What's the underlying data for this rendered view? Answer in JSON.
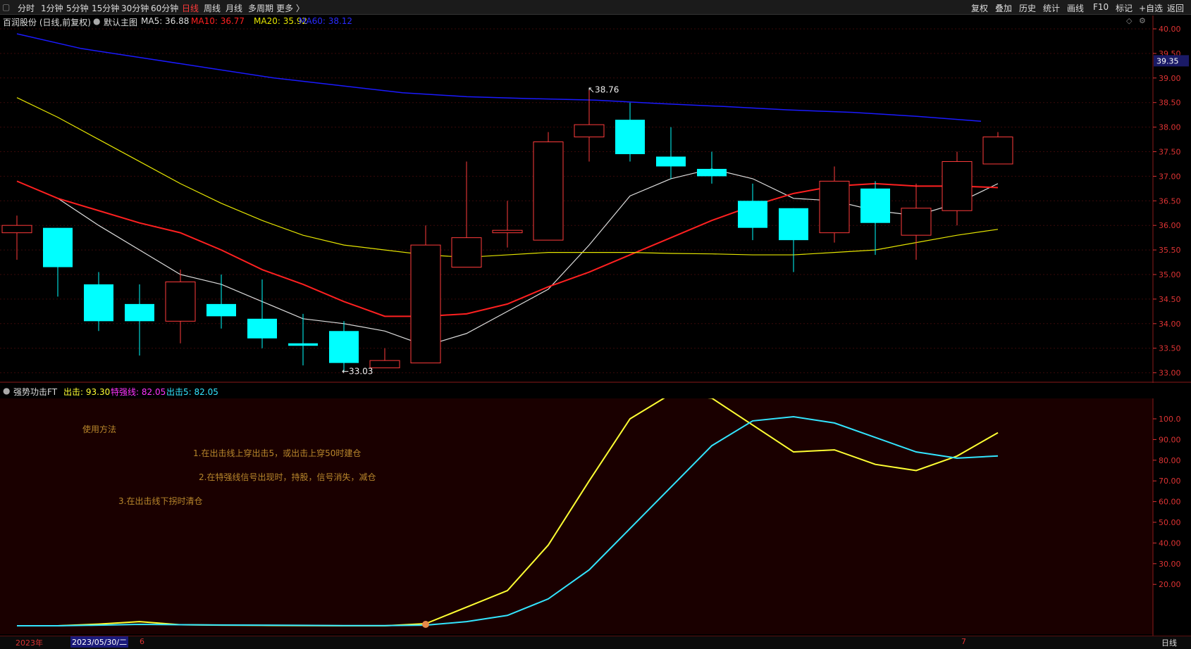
{
  "toolbar": {
    "left_items": [
      "分时",
      "1分钟",
      "5分钟",
      "15分钟",
      "30分钟",
      "60分钟",
      "日线",
      "周线",
      "月线",
      "多周期",
      "更多 〉"
    ],
    "active_item": "日线",
    "right_items": [
      "复权",
      "叠加",
      "历史",
      "统计",
      "画线",
      "F10",
      "标记",
      "+自选",
      "返回"
    ]
  },
  "main_panel": {
    "stock_title": "百润股份 (日线,前复权)",
    "indicator_name": "默认主图",
    "ma5": "MA5: 36.88",
    "ma10": "MA10: 36.77",
    "ma20": "MA20: 35.92",
    "ma60": "MA60: 38.12",
    "high_marker": "38.76",
    "low_marker": "33.03",
    "current_price_tag": "39.35",
    "y_ticks": [
      "40.00",
      "39.50",
      "39.00",
      "38.50",
      "38.00",
      "37.50",
      "37.00",
      "36.50",
      "36.00",
      "35.50",
      "35.00",
      "34.50",
      "34.00",
      "33.50",
      "33.00"
    ]
  },
  "sub_panel": {
    "indicator_name": "强势功击FT",
    "chuji": "出击: 93.30",
    "teqiang": "特强线: 82.05",
    "chuji5": "出击5: 82.05",
    "notes": [
      "使用方法",
      "1.在出击线上穿出击5，或出击上穿50时建仓",
      "2.在特强线信号出现时，持股，信号消失，减仓",
      "3.在出击线下拐时清仓"
    ],
    "y_ticks": [
      "100.0",
      "90.00",
      "80.00",
      "70.00",
      "60.00",
      "50.00",
      "40.00",
      "30.00",
      "20.00"
    ]
  },
  "bottom_bar": {
    "year_label": "2023年",
    "selected_date": "2023/05/30/二",
    "month_6": "6",
    "month_7": "7",
    "period_label": "日线"
  },
  "colors": {
    "up": "#ff3b3b",
    "down": "#00ffff",
    "ma5": "#dddddd",
    "ma10": "#ff2020",
    "ma20": "#e5e500",
    "ma60": "#1a1aff",
    "chuji": "#ffff33",
    "chuji5": "#33e5ff"
  },
  "chart_data": [
    {
      "type": "candlestick",
      "title": "百润股份 (日线,前复权)",
      "ylim": [
        32.8,
        40.1
      ],
      "candles": [
        {
          "open": 35.85,
          "close": 36.0,
          "high": 36.2,
          "low": 35.3
        },
        {
          "open": 35.95,
          "close": 35.15,
          "high": 35.95,
          "low": 34.55
        },
        {
          "open": 34.8,
          "close": 34.05,
          "high": 35.05,
          "low": 33.85
        },
        {
          "open": 34.4,
          "close": 34.05,
          "high": 34.8,
          "low": 33.35
        },
        {
          "open": 34.05,
          "close": 34.85,
          "high": 35.1,
          "low": 33.6
        },
        {
          "open": 34.4,
          "close": 34.15,
          "high": 35.0,
          "low": 33.9
        },
        {
          "open": 34.1,
          "close": 33.7,
          "high": 34.9,
          "low": 33.5
        },
        {
          "open": 33.6,
          "close": 33.55,
          "high": 34.2,
          "low": 33.15
        },
        {
          "open": 33.85,
          "close": 33.2,
          "high": 34.05,
          "low": 33.03
        },
        {
          "open": 33.1,
          "close": 33.25,
          "high": 33.5,
          "low": 33.1
        },
        {
          "open": 33.2,
          "close": 35.6,
          "high": 36.0,
          "low": 33.2
        },
        {
          "open": 35.15,
          "close": 35.75,
          "high": 37.3,
          "low": 35.15
        },
        {
          "open": 35.85,
          "close": 35.9,
          "high": 36.5,
          "low": 35.55
        },
        {
          "open": 35.7,
          "close": 37.7,
          "high": 37.9,
          "low": 35.7
        },
        {
          "open": 37.8,
          "close": 38.05,
          "high": 38.76,
          "low": 37.3
        },
        {
          "open": 38.15,
          "close": 37.45,
          "high": 38.5,
          "low": 37.3
        },
        {
          "open": 37.4,
          "close": 37.2,
          "high": 38.0,
          "low": 36.95
        },
        {
          "open": 37.15,
          "close": 37.0,
          "high": 37.5,
          "low": 36.85
        },
        {
          "open": 36.5,
          "close": 35.95,
          "high": 36.85,
          "low": 35.7
        },
        {
          "open": 36.35,
          "close": 35.7,
          "high": 36.35,
          "low": 35.05
        },
        {
          "open": 35.85,
          "close": 36.9,
          "high": 37.2,
          "low": 35.65
        },
        {
          "open": 36.75,
          "close": 36.05,
          "high": 36.9,
          "low": 35.4
        },
        {
          "open": 35.8,
          "close": 36.35,
          "high": 36.85,
          "low": 35.3
        },
        {
          "open": 36.3,
          "close": 37.3,
          "high": 37.5,
          "low": 36.0
        },
        {
          "open": 37.25,
          "close": 37.8,
          "high": 37.9,
          "low": 37.25
        }
      ],
      "series": [
        {
          "name": "MA5",
          "values": [
            36.55,
            36.0,
            35.5,
            35.0,
            34.8,
            34.45,
            34.1,
            34.0,
            33.85,
            33.55,
            33.8,
            34.25,
            34.7,
            35.6,
            36.6,
            36.95,
            37.15,
            36.95,
            36.55,
            36.5,
            36.3,
            36.2,
            36.45,
            36.85
          ]
        },
        {
          "name": "MA10",
          "values": [
            36.9,
            36.55,
            36.3,
            36.05,
            35.85,
            35.5,
            35.1,
            34.8,
            34.45,
            34.15,
            34.15,
            34.2,
            34.4,
            34.75,
            35.05,
            35.4,
            35.75,
            36.1,
            36.4,
            36.65,
            36.8,
            36.85,
            36.8,
            36.8,
            36.77
          ]
        },
        {
          "name": "MA20",
          "values": [
            38.6,
            38.2,
            37.75,
            37.3,
            36.85,
            36.45,
            36.1,
            35.8,
            35.6,
            35.5,
            35.4,
            35.35,
            35.4,
            35.45,
            35.45,
            35.45,
            35.43,
            35.42,
            35.4,
            35.4,
            35.45,
            35.5,
            35.65,
            35.8,
            35.92
          ]
        },
        {
          "name": "MA60",
          "values": [
            39.9,
            39.6,
            39.4,
            39.2,
            39.0,
            38.85,
            38.7,
            38.62,
            38.58,
            38.55,
            38.48,
            38.42,
            38.35,
            38.3,
            38.22,
            38.12
          ]
        }
      ]
    },
    {
      "type": "line",
      "title": "强势功击FT",
      "ylim": [
        0,
        112
      ],
      "series": [
        {
          "name": "出击",
          "values": [
            0,
            0,
            0.8,
            2.0,
            0.5,
            0.3,
            0.2,
            0.1,
            0,
            0,
            1.0,
            9,
            17,
            39,
            70,
            100,
            112,
            110,
            97,
            84,
            85,
            78,
            75,
            82,
            93.3
          ]
        },
        {
          "name": "出击5",
          "values": [
            0,
            0,
            0.3,
            0.7,
            0.5,
            0.4,
            0.3,
            0.2,
            0.1,
            0.1,
            0.3,
            2,
            5,
            13,
            27,
            47,
            67,
            87,
            99,
            101,
            98,
            91,
            84,
            81,
            82.05
          ]
        }
      ]
    }
  ]
}
